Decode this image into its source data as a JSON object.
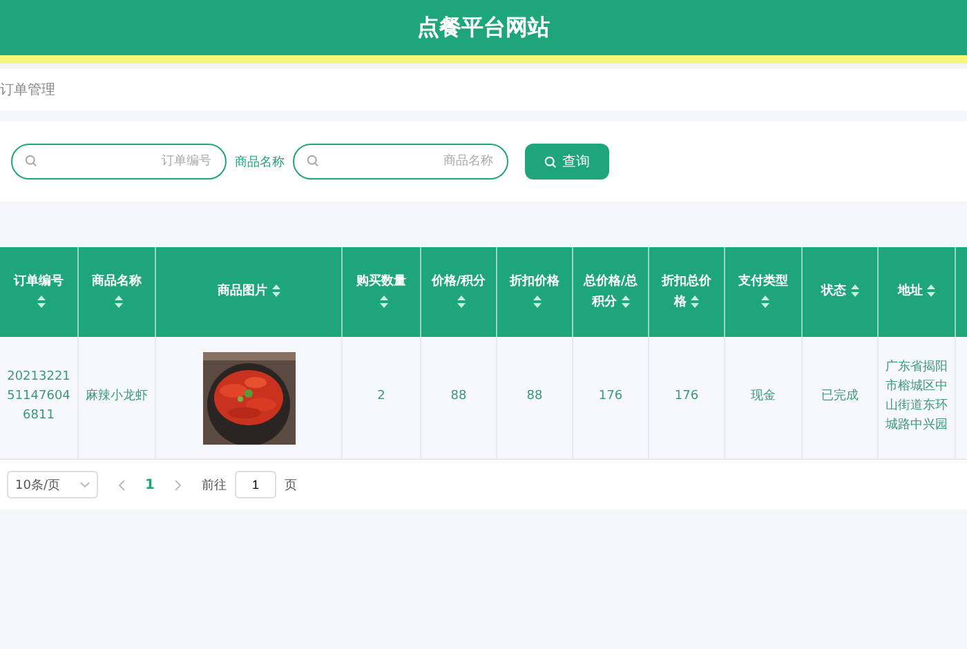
{
  "header": {
    "title": "点餐平台网站"
  },
  "breadcrumb": "订单管理",
  "search": {
    "fields": [
      {
        "placeholder": "订单编号"
      },
      {
        "label": "商品名称",
        "placeholder": "商品名称"
      }
    ],
    "button": "查询"
  },
  "table": {
    "columns": [
      {
        "label": "订单编号"
      },
      {
        "label": "商品名称"
      },
      {
        "label": "商品图片"
      },
      {
        "label": "购买数量"
      },
      {
        "label": "价格/积分"
      },
      {
        "label": "折扣价格"
      },
      {
        "label": "总价格/总积分"
      },
      {
        "label": "折扣总价格"
      },
      {
        "label": "支付类型"
      },
      {
        "label": "状态"
      },
      {
        "label": "地址"
      }
    ],
    "rows": [
      {
        "cells": [
          {
            "kind": "text",
            "text": "20213221511476046811"
          },
          {
            "kind": "text",
            "text": "麻辣小龙虾"
          },
          {
            "kind": "picture"
          },
          {
            "kind": "text",
            "text": "2"
          },
          {
            "kind": "text",
            "text": "88"
          },
          {
            "kind": "text",
            "text": "88"
          },
          {
            "kind": "text",
            "text": "176"
          },
          {
            "kind": "text",
            "text": "176"
          },
          {
            "kind": "text",
            "text": "现金"
          },
          {
            "kind": "text",
            "text": "已完成"
          },
          {
            "kind": "text",
            "text": "广东省揭阳市榕城区中山街道东环城路中兴园"
          }
        ]
      }
    ]
  },
  "pagination": {
    "page_size": "10条/页",
    "pages": [
      {
        "label": "1",
        "selected": true
      }
    ],
    "goto_label": "前往",
    "goto_value": "1",
    "page_unit": "页"
  }
}
